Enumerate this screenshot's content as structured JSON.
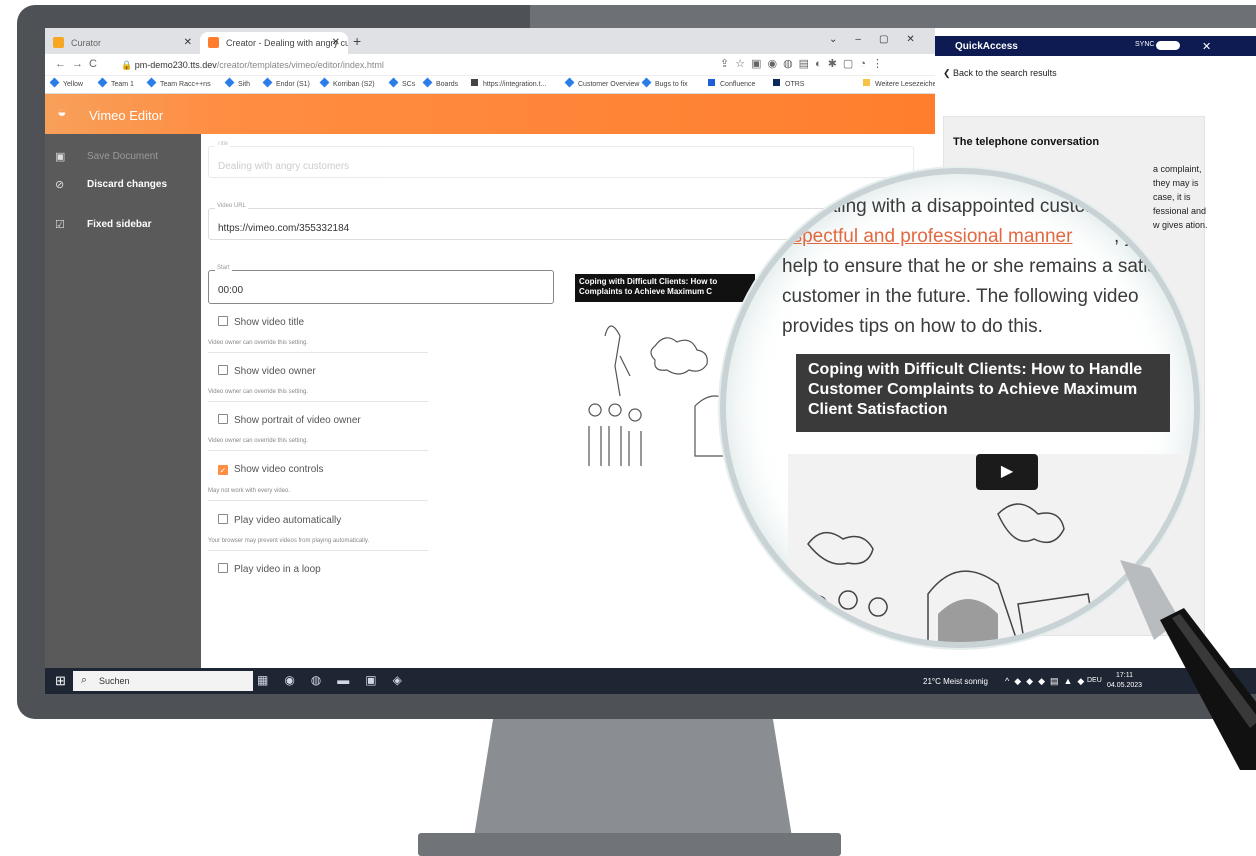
{
  "browser": {
    "tabs": [
      {
        "label": "Curator"
      },
      {
        "label": "Creator - Dealing with angry cus"
      }
    ],
    "url_host": "pm-demo230.tts.dev",
    "url_path": "/creator/templates/vimeo/editor/index.html",
    "bookmarks": [
      "Yellow",
      "Team 1",
      "Team Racc++ns",
      "Sith",
      "Endor (S1)",
      "Korriban (S2)",
      "SCs",
      "Boards",
      "https://integration.t...",
      "Customer Overview",
      "Bugs to fix",
      "Confluence",
      "OTRS"
    ],
    "bookmarks_more": "Weitere Lesezeichen"
  },
  "app": {
    "title": "Vimeo Editor",
    "sidebar": [
      {
        "label": "Save Document",
        "icon": "save-icon"
      },
      {
        "label": "Discard changes",
        "icon": "discard-icon"
      },
      {
        "label": "Fixed sidebar",
        "icon": "checkbox-icon"
      }
    ],
    "fields": {
      "title": {
        "label": "Title",
        "value": "Dealing with angry customers"
      },
      "video_url": {
        "label": "Video URL",
        "value": "https://vimeo.com/355332184"
      },
      "start": {
        "label": "Start",
        "value": "00:00"
      }
    },
    "options": [
      {
        "label": "Show video title",
        "checked": false,
        "hint": "Video owner can override this setting."
      },
      {
        "label": "Show video owner",
        "checked": false,
        "hint": "Video owner can override this setting."
      },
      {
        "label": "Show portrait of video owner",
        "checked": false,
        "hint": "Video owner can override this setting."
      },
      {
        "label": "Show video controls",
        "checked": true,
        "hint": "May not work with every video."
      },
      {
        "label": "Play video automatically",
        "checked": false,
        "hint": "Your browser may prevent videos from playing automatically."
      },
      {
        "label": "Play video in a loop",
        "checked": false,
        "hint": ""
      }
    ],
    "video_preview_title": "Coping with Difficult Clients: How to Complaints to Achieve Maximum C"
  },
  "quickaccess": {
    "title": "QuickAccess",
    "sync_label": "SYNC",
    "back_label": "Back to the search results",
    "card_title": "The telephone conversation",
    "side_text": "a complaint, they may is case, it is fessional and w gives ation."
  },
  "magnifier": {
    "line1": "ealing with a disappointed custom",
    "line2a": "espectful and professional manner",
    "line2b": ", you",
    "line3": "help to ensure that he or she remains a satisfi",
    "line4": "customer in the future. The following video",
    "line5": "provides tips on how to do this.",
    "video_title": "Coping with Difficult Clients: How to Handle Customer Complaints to Achieve Maximum Client Satisfaction",
    "accent": "#e2693f"
  },
  "taskbar": {
    "search": "Suchen",
    "weather": "21°C  Meist sonnig",
    "lang": "DEU",
    "time": "17:11",
    "date": "04.05.2023"
  }
}
